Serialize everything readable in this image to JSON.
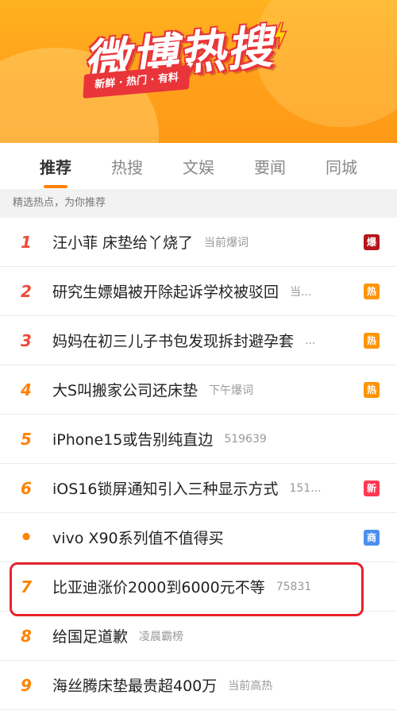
{
  "banner": {
    "title": "微博热搜",
    "slogan": "新鲜 · 热门 · 有料",
    "bolt_icon": "lightning-bolt-icon"
  },
  "tabs": [
    {
      "label": "推荐",
      "active": true
    },
    {
      "label": "热搜",
      "active": false
    },
    {
      "label": "文娱",
      "active": false
    },
    {
      "label": "要闻",
      "active": false
    },
    {
      "label": "同城",
      "active": false
    }
  ],
  "subheader": "精选热点，为你推荐",
  "items": [
    {
      "rank": "1",
      "title": "汪小菲 床垫给丫烧了",
      "meta": "当前爆词",
      "badge": "爆",
      "badge_color": "#b5151a"
    },
    {
      "rank": "2",
      "title": "研究生嫖娼被开除起诉学校被驳回",
      "meta": "当...",
      "badge": "热",
      "badge_color": "#ff9406"
    },
    {
      "rank": "3",
      "title": "妈妈在初三儿子书包发现拆封避孕套",
      "meta": "...",
      "badge": "热",
      "badge_color": "#ff9406"
    },
    {
      "rank": "4",
      "title": "大S叫搬家公司还床垫",
      "meta": "下午爆词",
      "badge": "热",
      "badge_color": "#ff9406"
    },
    {
      "rank": "5",
      "title": "iPhone15或告别纯直边",
      "meta": "519639",
      "badge": "",
      "badge_color": ""
    },
    {
      "rank": "6",
      "title": "iOS16锁屏通知引入三种显示方式",
      "meta": "151...",
      "badge": "新",
      "badge_color": "#ff3852"
    },
    {
      "rank": "•",
      "title": "vivo X90系列值不值得买",
      "meta": "",
      "badge": "商",
      "badge_color": "#4d8fef"
    },
    {
      "rank": "7",
      "title": "比亚迪涨价2000到6000元不等",
      "meta": "75831",
      "badge": "",
      "badge_color": ""
    },
    {
      "rank": "8",
      "title": "给国足道歉",
      "meta": "凌晨霸榜",
      "badge": "",
      "badge_color": ""
    },
    {
      "rank": "9",
      "title": "海丝腾床垫最贵超400万",
      "meta": "当前高热",
      "badge": "",
      "badge_color": ""
    }
  ]
}
